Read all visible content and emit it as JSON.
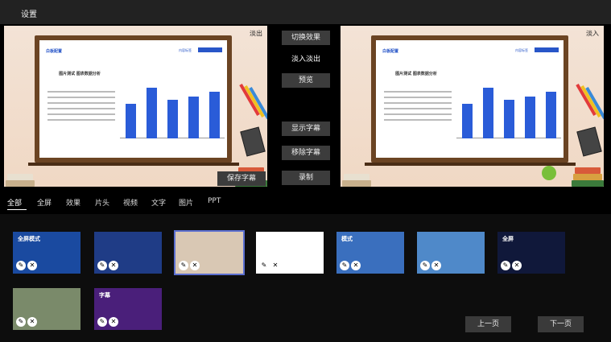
{
  "window": {
    "title": "设置"
  },
  "preview": {
    "left_corner": "淡出",
    "right_corner": "淡入",
    "slide_head": "白板配置",
    "slide_title": "图片测试 图表数据分析",
    "slide_tag": "内容标签"
  },
  "controls": {
    "switch_effect": "切换效果",
    "fade_in_out": "淡入淡出",
    "preview": "预览",
    "show_subtitle": "显示字幕",
    "move_subtitle": "移除字幕",
    "save_subtitle": "保存字幕",
    "record": "录制"
  },
  "tabs": [
    "全部",
    "全屏",
    "效果",
    "片头",
    "视频",
    "文字",
    "图片",
    "PPT"
  ],
  "gallery": {
    "items": [
      {
        "label": "全屏模式",
        "color": "#1a4aa0",
        "selected": false
      },
      {
        "label": "",
        "color": "#1f3c86",
        "selected": false
      },
      {
        "label": "",
        "color": "#d9c8b4",
        "selected": true
      },
      {
        "label": "",
        "color": "#ffffff",
        "selected": false
      },
      {
        "label": "模式",
        "color": "#3a6fbe",
        "selected": false
      },
      {
        "label": "",
        "color": "#4f89c9",
        "selected": false
      },
      {
        "label": "全屏",
        "color": "#10183a",
        "selected": false
      },
      {
        "label": "",
        "color": "#7a8a6a",
        "selected": false
      },
      {
        "label": "字幕",
        "color": "#4a1f7a",
        "selected": false
      }
    ]
  },
  "pager": {
    "prev": "上一页",
    "next": "下一页"
  },
  "chart_values": [
    60,
    88,
    66,
    72,
    80
  ]
}
